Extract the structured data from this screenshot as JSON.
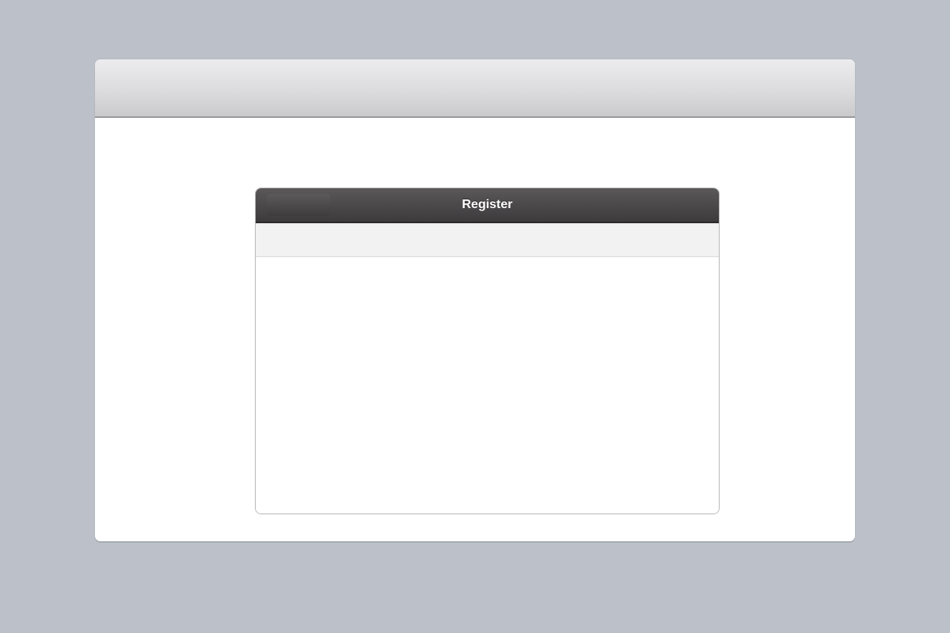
{
  "dialog": {
    "title": "Register"
  },
  "colors": {
    "page_background": "#bcc1c9",
    "window_background": "#ffffff",
    "titlebar_dark": "#4b494a",
    "toolbar_gray": "#f2f2f2"
  }
}
